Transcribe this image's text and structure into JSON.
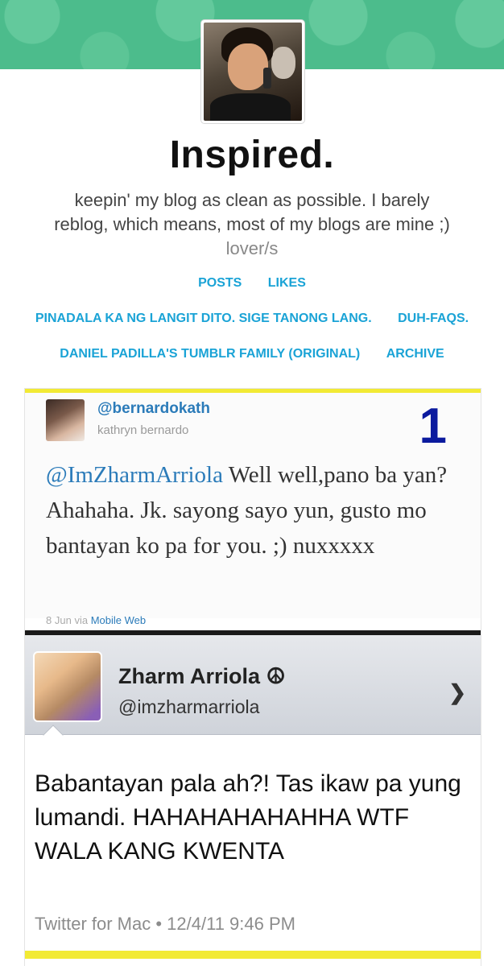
{
  "blog": {
    "title": "Inspired.",
    "description": "keepin' my blog as clean as possible. I barely reblog, which means, most of my blogs are mine ;)",
    "description_extra": "lover/s"
  },
  "nav": {
    "row1": [
      "POSTS",
      "LIKES"
    ],
    "row2": [
      "PINADALA KA NG LANGIT DITO. SIGE TANONG LANG.",
      "DUH-FAQS."
    ],
    "row3": [
      "DANIEL PADILLA'S TUMBLR FAMILY (ORIGINAL)",
      "ARCHIVE"
    ]
  },
  "post": {
    "tweet1": {
      "handle": "@bernardokath",
      "name": "kathryn bernardo",
      "number": "1",
      "mention": "@ImZharmArriola",
      "text": " Well well,pano ba yan? Ahahaha. Jk. sayong sayo yun, gusto mo bantayan ko pa for you. ;) nuxxxxx",
      "date": "8 Jun",
      "via_label": "via",
      "via": "Mobile Web"
    },
    "tweet2": {
      "name": "Zharm Arriola ☮",
      "handle": "@imzharmarriola",
      "text": "Babantayan pala ah?! Tas ikaw pa yung lumandi. HAHAHAHAHAHHA WTF WALA KANG KWENTA",
      "meta": "Twitter for Mac • 12/4/11 9:46 PM"
    }
  },
  "icons": {
    "chevron": "chevron-right-icon"
  },
  "colors": {
    "banner": "#4cbc8c",
    "link": "#1aa3d6",
    "twitter_blue": "#2b7bb9",
    "highlight_yellow": "#f2ea34",
    "number_blue": "#0b1a9e"
  }
}
